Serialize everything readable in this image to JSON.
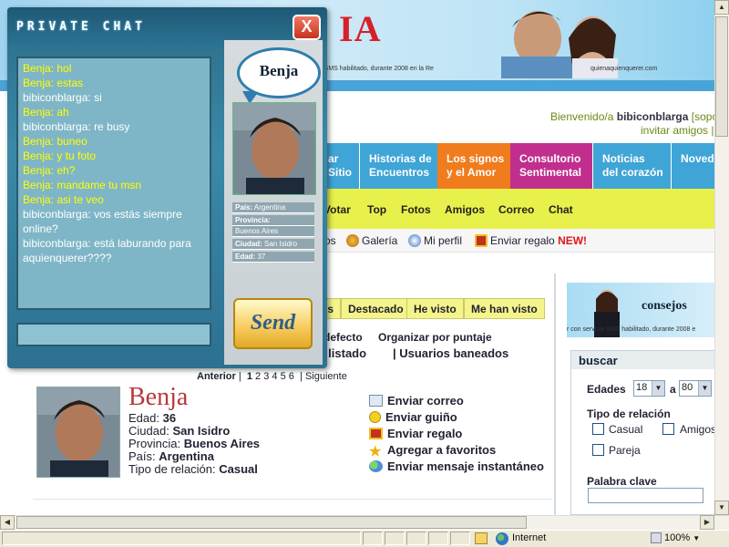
{
  "banner": {
    "logo_text": "IA",
    "sms_text": "servicio SMS habilitado, durante 2008 en la Re",
    "url_text": "quienaquienquerer.com"
  },
  "header": {
    "welcome_prefix": "Bienvenido/a",
    "username": "bibiconblarga",
    "welcome_link": "[soport",
    "invite_text": "invitar amigos | C"
  },
  "top_tabs": [
    {
      "label": "ar\nSitio",
      "color": "#3fa5d6"
    },
    {
      "label": "Historias de\nEncuentros",
      "color": "#3fa5d6"
    },
    {
      "label": "Los signos\ny el Amor",
      "color": "#f07c1e"
    },
    {
      "label": "Consultorio\nSentimental",
      "color": "#c02e8e"
    },
    {
      "label": "Noticias\ndel corazón",
      "color": "#3fa5d6"
    },
    {
      "label": "Noved",
      "color": "#3fa5d6"
    }
  ],
  "yellow_menu": [
    "Votar",
    "Top",
    "Fotos",
    "Amigos",
    "Correo",
    "Chat"
  ],
  "sub_menu": {
    "partial": "os",
    "galeria": "Galería",
    "perfil": "Mi perfil",
    "regalo": "Enviar regalo",
    "new_badge": "NEW!"
  },
  "view_tabs": {
    "partial": "os",
    "destacado": "Destacado",
    "he_visto": "He visto",
    "me_han_visto": "Me han visto"
  },
  "organize": {
    "defecto": "e defecto",
    "puntaje": "Organizar por puntaje",
    "listado": "ta listado",
    "baneados": "| Usuarios baneados"
  },
  "pager": {
    "prev": "Anterior",
    "sep1": "|",
    "pages": [
      "1",
      "2",
      "3",
      "4",
      "5",
      "6"
    ],
    "sep2": "|",
    "next": "Siguiente"
  },
  "profile": {
    "name": "Benja",
    "edad_label": "Edad:",
    "edad": "36",
    "ciudad_label": "Ciudad:",
    "ciudad": "San Isidro",
    "provincia_label": "Provincia:",
    "provincia": "Buenos Aires",
    "pais_label": "País:",
    "pais": "Argentina",
    "relacion_label": "Tipo de relación:",
    "relacion": "Casual"
  },
  "actions": [
    {
      "label": "Enviar correo",
      "icon": "envelope-icon"
    },
    {
      "label": "Enviar guiño",
      "icon": "smiley-icon"
    },
    {
      "label": "Enviar regalo",
      "icon": "gift-icon"
    },
    {
      "label": "Agregar a favoritos",
      "icon": "star-icon"
    },
    {
      "label": "Enviar mensaje instantáneo",
      "icon": "messenger-icon"
    }
  ],
  "consejos": {
    "title": "consejos",
    "sms_text": "r con servicio SMS habilitado, durante 2008 e"
  },
  "buscar": {
    "title": "buscar",
    "edades_label": "Edades",
    "edad_min": "18",
    "a_label": "a",
    "edad_max": "80",
    "tipo_label": "Tipo de relación",
    "casual": "Casual",
    "amigos": "Amigos",
    "pareja": "Pareja",
    "keyword_label": "Palabra clave"
  },
  "chat": {
    "title": "PRIVATE CHAT",
    "close_symbol": "X",
    "partner_name": "Benja",
    "pais_label": "País:",
    "pais": "Argentina",
    "provincia_label": "Provincia:",
    "provincia": "Buenos Aires",
    "ciudad_label": "Ciudad:",
    "ciudad": "San Isidro",
    "edad_label": "Edad:",
    "edad": "37",
    "send_label": "Send",
    "messages": [
      {
        "user": "Benja:",
        "text": "hol",
        "who": "b"
      },
      {
        "user": "Benja:",
        "text": "estas",
        "who": "b"
      },
      {
        "user": "bibiconblarga:",
        "text": "si",
        "who": "o"
      },
      {
        "user": "Benja:",
        "text": "ah",
        "who": "b"
      },
      {
        "user": "bibiconblarga:",
        "text": "re busy",
        "who": "o"
      },
      {
        "user": "Benja:",
        "text": "buneo",
        "who": "b"
      },
      {
        "user": "Benja:",
        "text": "y tu foto",
        "who": "b"
      },
      {
        "user": "Benja:",
        "text": "eh?",
        "who": "b"
      },
      {
        "user": "Benja:",
        "text": "mandame tu msn",
        "who": "b"
      },
      {
        "user": "Benja:",
        "text": "asi te veo",
        "who": "b"
      },
      {
        "user": "bibiconblarga:",
        "text": "vos estás siempre online?",
        "who": "o"
      },
      {
        "user": "bibiconblarga:",
        "text": "está laburando para aquienquerer????",
        "who": "o"
      }
    ]
  },
  "statusbar": {
    "zone": "Internet",
    "zoom": "100%"
  },
  "colors": {
    "chat_bg": "#2d7090",
    "chat_log_bg": "#7fb6c7",
    "partner_text": "#ffff00",
    "brand_red": "#d8202a",
    "menu_yellow": "#e8f04c"
  }
}
